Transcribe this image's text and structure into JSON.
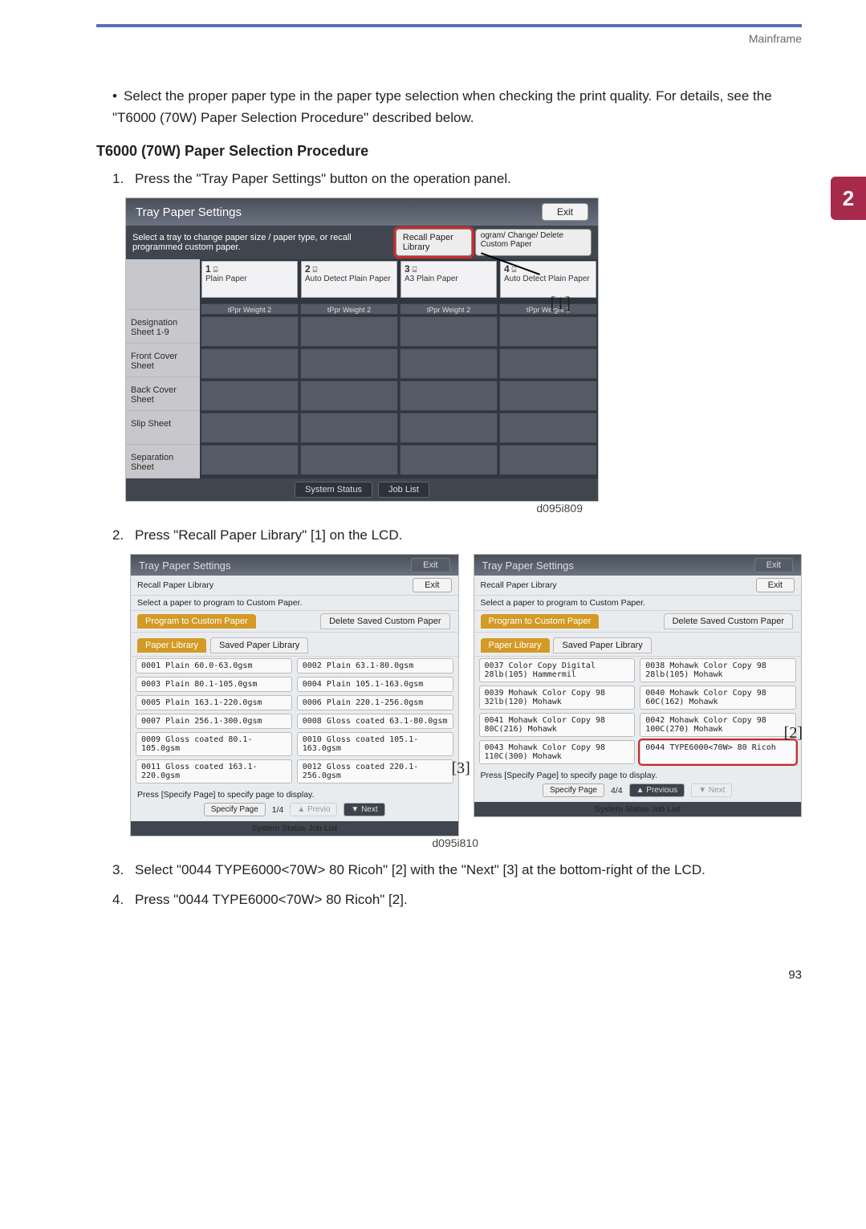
{
  "header": {
    "breadcrumb": "Mainframe"
  },
  "sidetab": "2",
  "bullet": "Select the proper paper type in the paper type selection when checking the print quality. For details, see the \"T6000 (70W) Paper Selection Procedure\" described below.",
  "heading": "T6000 (70W) Paper Selection Procedure",
  "step1": {
    "n": "1.",
    "text": "Press the \"Tray Paper Settings\" button on the operation panel."
  },
  "step2": {
    "n": "2.",
    "text": "Press \"Recall Paper Library\" [1] on the LCD."
  },
  "step3": {
    "n": "3.",
    "text": "Select \"0044 TYPE6000<70W> 80 Ricoh\" [2] with the \"Next\" [3] at the bottom-right of the LCD."
  },
  "step4": {
    "n": "4.",
    "text": "Press \"0044 TYPE6000<70W> 80 Ricoh\" [2]."
  },
  "fig1": {
    "title": "Tray Paper Settings",
    "exit": "Exit",
    "subtext": "Select a tray to change paper size / paper type, or recall programmed custom paper.",
    "recall": "Recall Paper Library",
    "pgm": "ogram/ Change/ Delete Custom Paper",
    "trayheads": [
      {
        "n": "1",
        "d": "Plain Paper"
      },
      {
        "n": "2",
        "d": "Auto Detect  Plain Paper"
      },
      {
        "n": "3",
        "d": "A3  Plain Paper"
      },
      {
        "n": "4",
        "d": "Auto Detect  Plain Paper"
      }
    ],
    "weight": "tPpr Weight 2",
    "rowlabels": [
      "Designation Sheet 1-9",
      "Front Cover Sheet",
      "Back Cover Sheet",
      "Slip Sheet",
      "Separation Sheet"
    ],
    "footer": {
      "sys": "System Status",
      "jobs": "Job List"
    },
    "callout": "[1]",
    "caption": "d095i809"
  },
  "fig2": {
    "left": {
      "title": "Tray Paper Settings",
      "exit_grey": "Exit",
      "recall_lbl": "Recall Paper Library",
      "exit_w": "Exit",
      "sel_lbl": "Select a paper to program to Custom Paper.",
      "btn_prog": "Program to Custom Paper",
      "btn_del": "Delete Saved Custom Paper",
      "tab_sel": "Paper Library",
      "tab_unsel": "Saved Paper Library",
      "rows": [
        [
          "0001 Plain 60.0-63.0gsm",
          "0002 Plain 63.1-80.0gsm"
        ],
        [
          "0003 Plain 80.1-105.0gsm",
          "0004 Plain 105.1-163.0gsm"
        ],
        [
          "0005 Plain 163.1-220.0gsm",
          "0006 Plain 220.1-256.0gsm"
        ],
        [
          "0007 Plain 256.1-300.0gsm",
          "0008 Gloss coated 63.1-80.0gsm"
        ],
        [
          "0009 Gloss coated 80.1-105.0gsm",
          "0010 Gloss coated 105.1-163.0gsm"
        ],
        [
          "0011 Gloss coated 163.1-220.0gsm",
          "0012 Gloss coated 220.1-256.0gsm"
        ]
      ],
      "bottom_lbl": "Press [Specify Page] to specify page to display.",
      "specify": "Specify Page",
      "page": "1/4",
      "prev": "▲ Previo",
      "next": "▼ Next"
    },
    "right": {
      "title": "Tray Paper Settings",
      "exit_grey": "Exit",
      "recall_lbl": "Recall Paper Library",
      "exit_w": "Exit",
      "sel_lbl": "Select a paper to program to Custom Paper.",
      "btn_prog": "Program to Custom Paper",
      "btn_del": "Delete Saved Custom Paper",
      "tab_sel": "Paper Library",
      "tab_unsel": "Saved Paper Library",
      "rows": [
        [
          "0037 Color Copy Digital 28lb(105) Hammermil",
          "0038 Mohawk Color Copy 98 28lb(105) Mohawk"
        ],
        [
          "0039 Mohawk Color Copy 98 32lb(120) Mohawk",
          "0040 Mohawk Color Copy 98 60C(162) Mohawk"
        ],
        [
          "0041 Mohawk Color Copy 98 80C(216) Mohawk",
          "0042 Mohawk Color Copy 98 100C(270) Mohawk"
        ],
        [
          "0043 Mohawk Color Copy 98 110C(300) Mohawk",
          "0044 TYPE6000<70W> 80 Ricoh"
        ]
      ],
      "bottom_lbl": "Press [Specify Page] to specify page to display.",
      "specify": "Specify Page",
      "page": "4/4",
      "prev": "▲ Previous",
      "next": "▼ Next"
    },
    "callout2": "[2]",
    "callout3": "[3]",
    "caption": "d095i810",
    "footer": {
      "sys": "System Status",
      "jobs": "Job List"
    }
  },
  "pageno": "93"
}
